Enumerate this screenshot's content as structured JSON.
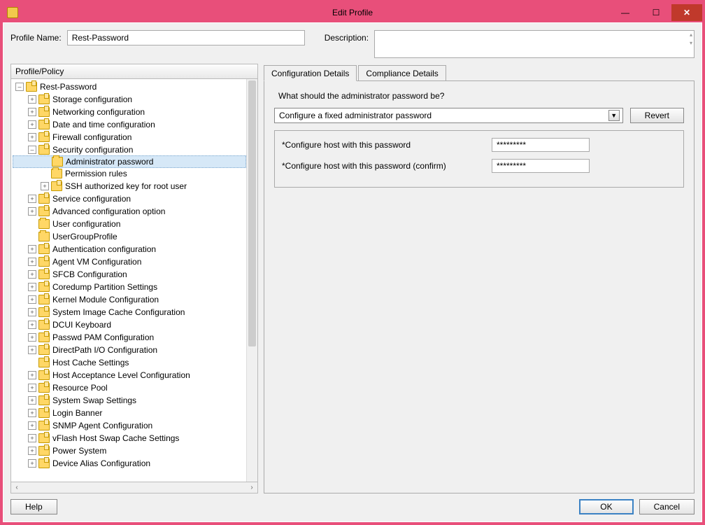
{
  "window": {
    "title": "Edit Profile"
  },
  "header": {
    "profile_name_label": "Profile Name:",
    "profile_name_value": "Rest-Password",
    "description_label": "Description:",
    "description_value": ""
  },
  "tree": {
    "header": "Profile/Policy",
    "root": "Rest-Password",
    "security_children": {
      "admin_pw": "Administrator password",
      "perm_rules": "Permission rules",
      "ssh_key": "SSH authorized key for root user"
    },
    "items": [
      "Storage configuration",
      "Networking configuration",
      "Date and time configuration",
      "Firewall configuration",
      "Security configuration",
      "Service configuration",
      "Advanced configuration option",
      "User configuration",
      "UserGroupProfile",
      "Authentication configuration",
      "Agent VM Configuration",
      "SFCB Configuration",
      "Coredump Partition Settings",
      "Kernel Module Configuration",
      "System Image Cache Configuration",
      "DCUI Keyboard",
      "Passwd PAM Configuration",
      "DirectPath I/O Configuration",
      "Host Cache Settings",
      "Host Acceptance Level Configuration",
      "Resource Pool",
      "System Swap Settings",
      "Login Banner",
      "SNMP Agent Configuration",
      "vFlash Host Swap Cache Settings",
      "Power System",
      "Device Alias Configuration"
    ],
    "expandable_indices": [
      0,
      1,
      2,
      3,
      4,
      5,
      6,
      9,
      10,
      11,
      12,
      13,
      14,
      15,
      16,
      17,
      19,
      20,
      21,
      22,
      23,
      24,
      25,
      26
    ],
    "profile_icon_indices": [
      0,
      1,
      2,
      3,
      4,
      5,
      6,
      9,
      10,
      11,
      12,
      13,
      14,
      15,
      16,
      17,
      18,
      19,
      20,
      21,
      22,
      23,
      24,
      25,
      26
    ]
  },
  "tabs": {
    "config": "Configuration Details",
    "compliance": "Compliance Details"
  },
  "details": {
    "question": "What should the administrator password be?",
    "dropdown_value": "Configure a fixed administrator password",
    "revert": "Revert",
    "field1_label": "*Configure host with this password",
    "field1_value": "*********",
    "field2_label": "*Configure host with this password (confirm)",
    "field2_value": "*********"
  },
  "footer": {
    "help": "Help",
    "ok": "OK",
    "cancel": "Cancel"
  }
}
